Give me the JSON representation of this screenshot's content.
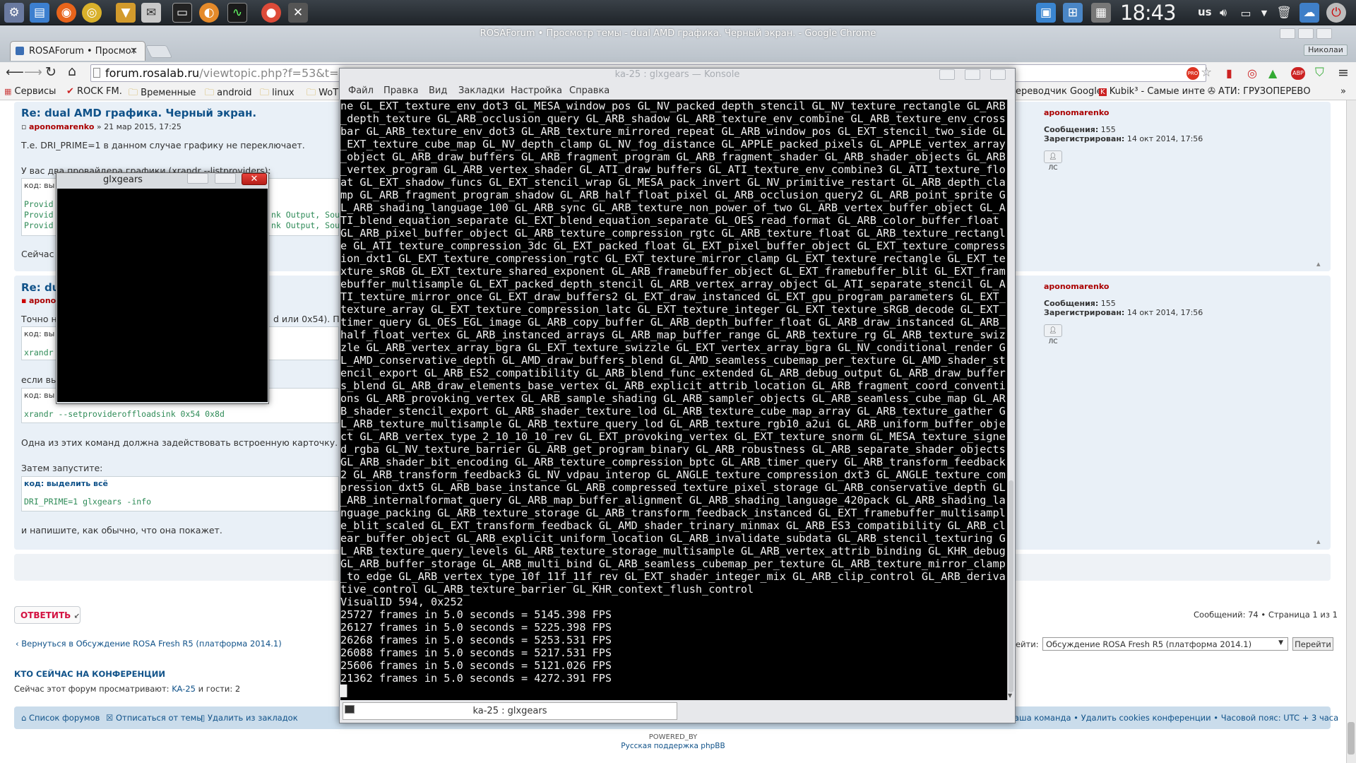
{
  "taskbar": {
    "clock": "18:43",
    "keyboard_layout": "us"
  },
  "chrome": {
    "window_title": "ROSAForum • Просмотр темы - dual AMD графика. Черный экран. - Google Chrome",
    "tab_title": "ROSAForum • Просмот",
    "user_badge": "Николаи",
    "url_host": "forum.rosalab.ru",
    "url_path": "/viewtopic.php?f=53&t=53488",
    "bookmarks": [
      "Сервисы",
      "ROCK FM.",
      "Временные",
      "android",
      "linux",
      "WoT"
    ],
    "bookmarks_right": [
      "ереводчик Google",
      "Kubik³ - Самые инте",
      "АТИ: ГРУЗОПЕРЕВО"
    ]
  },
  "forum": {
    "post1": {
      "title": "Re: dual AMD графика. Черный экран.",
      "author": "aponomarenko",
      "date": "» 21 мар 2015, 17:25",
      "line1": "Т.е. DRI_PRIME=1 в данном случае графику не переключает.",
      "line2": "У вас два провайдера графики (xrandr --listproviders):",
      "code_label": "код: вы",
      "code_lines": [
        "Provid",
        "Provid",
        "Provid"
      ],
      "code_right": [
        "nk Output, Sou",
        "nk Output, Sou"
      ],
      "after": "Сейчас п"
    },
    "post2": {
      "title": "Re: dual",
      "author": "apono",
      "line1": "Точно н",
      "line1_right": "d или 0x54). Поп",
      "code1_label": "код: вы",
      "code1": "xrandr",
      "if_text": "если вы",
      "code2_label": "код: вы",
      "code2": "xrandr --setprovideroffloadsink 0x54 0x8d",
      "note": "Одна из этих команд должна задействовать встроенную карточку.",
      "then": "Затем запустите:",
      "code3_label": "код:",
      "code3_select": "выделить всё",
      "code3": "DRI_PRIME=1 glxgears -info",
      "closing": "и напишите, как обычно, что она покажет."
    },
    "profile": {
      "name": "aponomarenko",
      "messages_label": "Сообщения:",
      "messages": "155",
      "registered_label": "Зарегистрирован:",
      "registered": "14 окт 2014, 17:56",
      "pm": "ЛС"
    },
    "reply_button": "ОТВЕТИТЬ",
    "pagination": "Сообщений: 74 • Страница 1 из 1",
    "back_link": "Вернуться в Обсуждение ROSA Fresh R5 (платформа 2014.1)",
    "jump_label": "ейти:",
    "jump_select": "Обсуждение ROSA Fresh R5 (платформа 2014.1)",
    "jump_button": "Перейти",
    "who_online_title": "КТО СЕЙЧАС НА КОНФЕРЕНЦИИ",
    "who_online_text": "Сейчас этот форум просматривают:",
    "who_online_user": "KA-25",
    "who_online_rest": "и гости: 2",
    "footer_links": [
      "Список форумов",
      "Отписаться от темы",
      "Удалить из закладок"
    ],
    "footer_right": "аша команда • Удалить cookies конференции • Часовой пояс: UTC + 3 часа",
    "powered": "POWERED_BY",
    "support": "Русская поддержка phpBB"
  },
  "glxgears": {
    "title": "glxgears"
  },
  "konsole": {
    "title": "ka-25 : glxgears — Konsole",
    "menu": [
      "Файл",
      "Правка",
      "Вид",
      "Закладки",
      "Настройка",
      "Справка"
    ],
    "tab": "ka-25 : glxgears",
    "output": "ne GL_EXT_texture_env_dot3 GL_MESA_window_pos GL_NV_packed_depth_stencil GL_NV_texture_rectangle GL_ARB_depth_texture GL_ARB_occlusion_query GL_ARB_shadow GL_ARB_texture_env_combine GL_ARB_texture_env_crossbar GL_ARB_texture_env_dot3 GL_ARB_texture_mirrored_repeat GL_ARB_window_pos GL_EXT_stencil_two_side GL_EXT_texture_cube_map GL_NV_depth_clamp GL_NV_fog_distance GL_APPLE_packed_pixels GL_APPLE_vertex_array_object GL_ARB_draw_buffers GL_ARB_fragment_program GL_ARB_fragment_shader GL_ARB_shader_objects GL_ARB_vertex_program GL_ARB_vertex_shader GL_ATI_draw_buffers GL_ATI_texture_env_combine3 GL_ATI_texture_float GL_EXT_shadow_funcs GL_EXT_stencil_wrap GL_MESA_pack_invert GL_NV_primitive_restart GL_ARB_depth_clamp GL_ARB_fragment_program_shadow GL_ARB_half_float_pixel GL_ARB_occlusion_query2 GL_ARB_point_sprite GL_ARB_shading_language_100 GL_ARB_sync GL_ARB_texture_non_power_of_two GL_ARB_vertex_buffer_object GL_ATI_blend_equation_separate GL_EXT_blend_equation_separate GL_OES_read_format GL_ARB_color_buffer_float GL_ARB_pixel_buffer_object GL_ARB_texture_compression_rgtc GL_ARB_texture_float GL_ARB_texture_rectangle GL_ATI_texture_compression_3dc GL_EXT_packed_float GL_EXT_pixel_buffer_object GL_EXT_texture_compression_dxt1 GL_EXT_texture_compression_rgtc GL_EXT_texture_mirror_clamp GL_EXT_texture_rectangle GL_EXT_texture_sRGB GL_EXT_texture_shared_exponent GL_ARB_framebuffer_object GL_EXT_framebuffer_blit GL_EXT_framebuffer_multisample GL_EXT_packed_depth_stencil GL_ARB_vertex_array_object GL_ATI_separate_stencil GL_ATI_texture_mirror_once GL_EXT_draw_buffers2 GL_EXT_draw_instanced GL_EXT_gpu_program_parameters GL_EXT_texture_array GL_EXT_texture_compression_latc GL_EXT_texture_integer GL_EXT_texture_sRGB_decode GL_EXT_timer_query GL_OES_EGL_image GL_ARB_copy_buffer GL_ARB_depth_buffer_float GL_ARB_draw_instanced GL_ARB_half_float_vertex GL_ARB_instanced_arrays GL_ARB_map_buffer_range GL_ARB_texture_rg GL_ARB_texture_swizzle GL_ARB_vertex_array_bgra GL_EXT_texture_swizzle GL_EXT_vertex_array_bgra GL_NV_conditional_render GL_AMD_conservative_depth GL_AMD_draw_buffers_blend GL_AMD_seamless_cubemap_per_texture GL_AMD_shader_stencil_export GL_ARB_ES2_compatibility GL_ARB_blend_func_extended GL_ARB_debug_output GL_ARB_draw_buffers_blend GL_ARB_draw_elements_base_vertex GL_ARB_explicit_attrib_location GL_ARB_fragment_coord_conventions GL_ARB_provoking_vertex GL_ARB_sample_shading GL_ARB_sampler_objects GL_ARB_seamless_cube_map GL_ARB_shader_stencil_export GL_ARB_shader_texture_lod GL_ARB_texture_cube_map_array GL_ARB_texture_gather GL_ARB_texture_multisample GL_ARB_texture_query_lod GL_ARB_texture_rgb10_a2ui GL_ARB_uniform_buffer_object GL_ARB_vertex_type_2_10_10_10_rev GL_EXT_provoking_vertex GL_EXT_texture_snorm GL_MESA_texture_signed_rgba GL_NV_texture_barrier GL_ARB_get_program_binary GL_ARB_robustness GL_ARB_separate_shader_objects GL_ARB_shader_bit_encoding GL_ARB_texture_compression_bptc GL_ARB_timer_query GL_ARB_transform_feedback2 GL_ARB_transform_feedback3 GL_NV_vdpau_interop GL_ANGLE_texture_compression_dxt3 GL_ANGLE_texture_compression_dxt5 GL_ARB_base_instance GL_ARB_compressed_texture_pixel_storage GL_ARB_conservative_depth GL_ARB_internalformat_query GL_ARB_map_buffer_alignment GL_ARB_shading_language_420pack GL_ARB_shading_language_packing GL_ARB_texture_storage GL_ARB_transform_feedback_instanced GL_EXT_framebuffer_multisample_blit_scaled GL_EXT_transform_feedback GL_AMD_shader_trinary_minmax GL_ARB_ES3_compatibility GL_ARB_clear_buffer_object GL_ARB_explicit_uniform_location GL_ARB_invalidate_subdata GL_ARB_stencil_texturing GL_ARB_texture_query_levels GL_ARB_texture_storage_multisample GL_ARB_vertex_attrib_binding GL_KHR_debug GL_ARB_buffer_storage GL_ARB_multi_bind GL_ARB_seamless_cubemap_per_texture GL_ARB_texture_mirror_clamp_to_edge GL_ARB_vertex_type_10f_11f_11f_rev GL_EXT_shader_integer_mix GL_ARB_clip_control GL_ARB_derivative_control GL_ARB_texture_barrier GL_KHR_context_flush_control\nVisualID 594, 0x252\n25727 frames in 5.0 seconds = 5145.398 FPS\n26127 frames in 5.0 seconds = 5225.398 FPS\n26268 frames in 5.0 seconds = 5253.531 FPS\n26088 frames in 5.0 seconds = 5217.531 FPS\n25606 frames in 5.0 seconds = 5121.026 FPS\n21362 frames in 5.0 seconds = 4272.391 FPS\n█"
  }
}
